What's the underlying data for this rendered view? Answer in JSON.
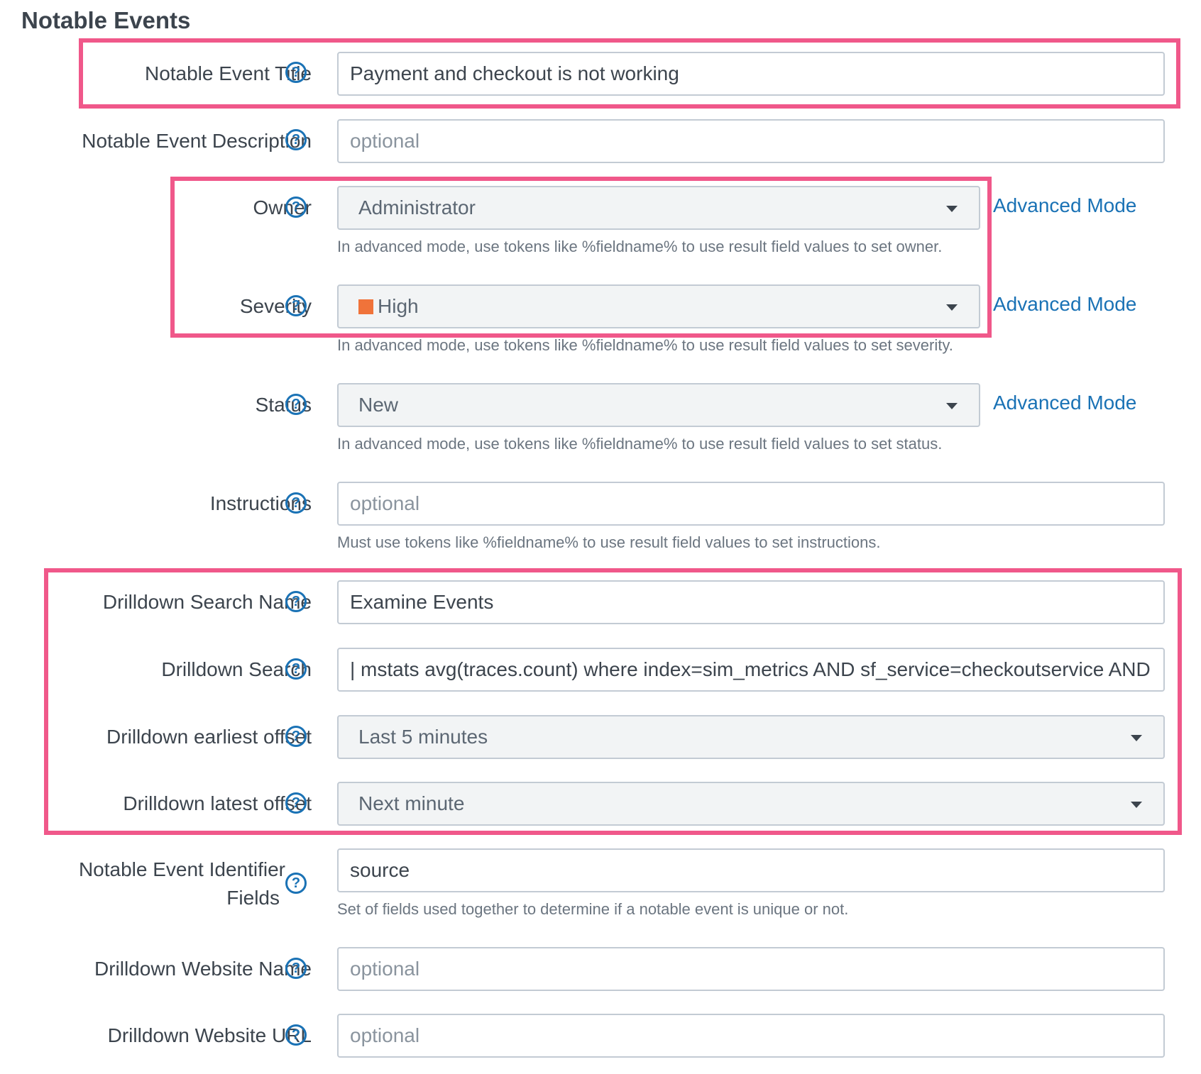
{
  "section_title": "Notable Events",
  "colors": {
    "highlight": "#f0588a",
    "link": "#1a72b5",
    "severity_high": "#f0733a"
  },
  "fields": {
    "title": {
      "label": "Notable Event Title",
      "value": "Payment and checkout is not working"
    },
    "description": {
      "label": "Notable Event Description",
      "placeholder": "optional"
    },
    "owner": {
      "label": "Owner",
      "value": "Administrator",
      "advanced_link": "Advanced Mode",
      "hint": "In advanced mode, use tokens like %fieldname% to use result field values to set owner."
    },
    "severity": {
      "label": "Severity",
      "value": "High",
      "advanced_link": "Advanced Mode",
      "hint": "In advanced mode, use tokens like %fieldname% to use result field values to set severity."
    },
    "status": {
      "label": "Status",
      "value": "New",
      "advanced_link": "Advanced Mode",
      "hint": "In advanced mode, use tokens like %fieldname% to use result field values to set status."
    },
    "instructions": {
      "label": "Instructions",
      "placeholder": "optional",
      "hint": "Must use tokens like %fieldname% to use result field values to set instructions."
    },
    "drilldown_search_name": {
      "label": "Drilldown Search Name",
      "value": "Examine Events"
    },
    "drilldown_search": {
      "label": "Drilldown Search",
      "value": "| mstats avg(traces.count) where index=sim_metrics AND sf_service=checkoutservice AND s"
    },
    "drilldown_earliest": {
      "label": "Drilldown earliest offset",
      "value": "Last 5 minutes"
    },
    "drilldown_latest": {
      "label": "Drilldown latest offset",
      "value": "Next minute"
    },
    "identifier_fields": {
      "label_line1": "Notable Event Identifier",
      "label_line2": "Fields",
      "value": "source",
      "hint": "Set of fields used together to determine if a notable event is unique or not."
    },
    "website_name": {
      "label": "Drilldown Website Name",
      "placeholder": "optional"
    },
    "website_url": {
      "label": "Drilldown Website URL",
      "placeholder": "optional"
    }
  },
  "help_icon_glyph": "?"
}
